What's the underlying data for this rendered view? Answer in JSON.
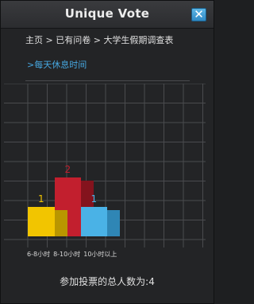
{
  "window": {
    "title": "Unique Vote",
    "close_icon": "close-icon"
  },
  "breadcrumb": {
    "home": "主页",
    "sep": " > ",
    "answered": "已有问卷",
    "survey": "大学生假期调查表"
  },
  "question": {
    "label": ">每天休息时间"
  },
  "colors": {
    "accent": "#46a7e0",
    "bar1": "#f2c500",
    "bar2": "#c21f2e",
    "bar3": "#4ab2e6"
  },
  "chart_data": {
    "type": "bar",
    "categories": [
      "6-8小时",
      "8-10小时",
      "10小时以上"
    ],
    "values": [
      1,
      2,
      1
    ],
    "ylim": [
      0,
      5
    ],
    "grid": true
  },
  "footer": {
    "total": "参加投票的总人数为:4"
  }
}
